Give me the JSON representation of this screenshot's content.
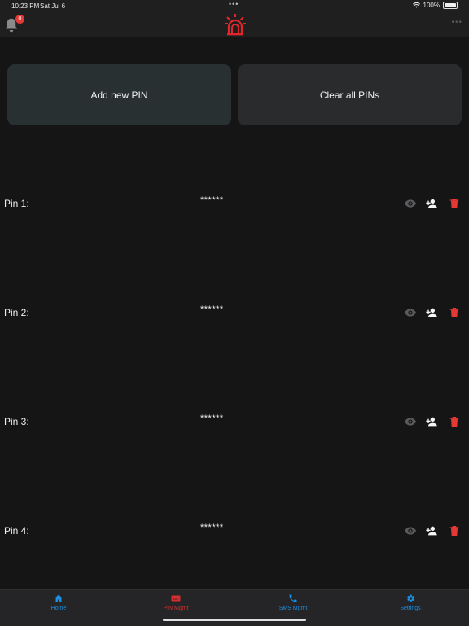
{
  "status_bar": {
    "time": "10:23 PM",
    "date": "Sat Jul 6",
    "dots": "•••",
    "battery": "100%"
  },
  "header": {
    "notification_count": "0",
    "logo_icon": "alarm-siren-icon",
    "more_dots": "•••"
  },
  "actions": {
    "add_label": "Add new PIN",
    "clear_label": "Clear all PINs"
  },
  "pins": [
    {
      "label": "Pin 1:",
      "value": "******"
    },
    {
      "label": "Pin 2:",
      "value": "******"
    },
    {
      "label": "Pin 3:",
      "value": "******"
    },
    {
      "label": "Pin 4:",
      "value": "******"
    }
  ],
  "tabs": [
    {
      "label": "Home",
      "icon": "home-icon",
      "color": "#1a8fe3"
    },
    {
      "label": "PIN Mgmt",
      "icon": "pin-icon",
      "color": "#d32f2f"
    },
    {
      "label": "SMS Mgmt",
      "icon": "phone-icon",
      "color": "#1a8fe3"
    },
    {
      "label": "Settings",
      "icon": "gear-icon",
      "color": "#1a8fe3"
    }
  ],
  "colors": {
    "accent": "#1a8fe3",
    "danger": "#e53935",
    "brand": "#e0262b"
  }
}
